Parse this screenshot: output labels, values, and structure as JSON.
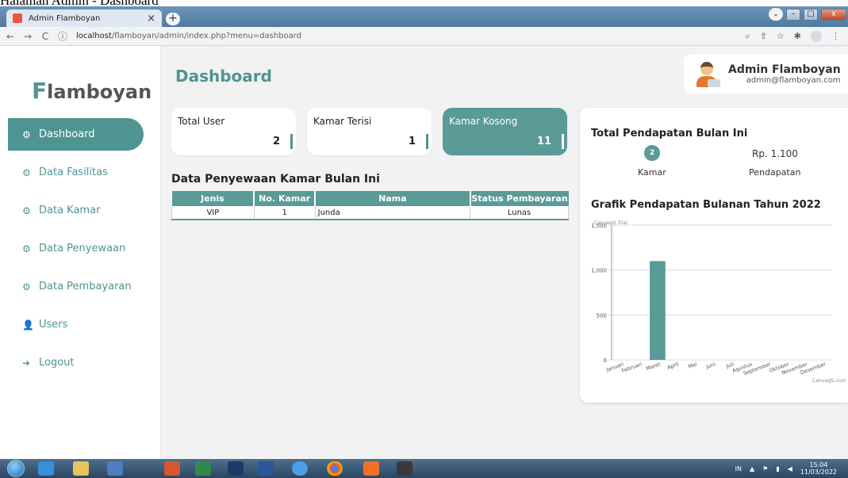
{
  "window_title": "Halaman Admin - Dashboard",
  "browser": {
    "tab_title": "Admin Flamboyan",
    "tab_close": "×",
    "new_tab": "+",
    "url_host": "localhost",
    "url_path": "/flamboyan/admin/index.php?menu=dashboard",
    "window_buttons": {
      "minimize": "–",
      "maximize": "□",
      "close": "x",
      "dropdown": "⌄"
    }
  },
  "brand": {
    "first_letter": "F",
    "rest": "lamboyan"
  },
  "sidebar": {
    "items": [
      {
        "label": "Dashboard",
        "icon": "gauge-icon",
        "glyph": "⚙",
        "active": true
      },
      {
        "label": "Data Fasilitas",
        "icon": "gauge-icon",
        "glyph": "⚙",
        "active": false
      },
      {
        "label": "Data Kamar",
        "icon": "gauge-icon",
        "glyph": "⚙",
        "active": false
      },
      {
        "label": "Data Penyewaan",
        "icon": "gauge-icon",
        "glyph": "⚙",
        "active": false
      },
      {
        "label": "Data Pembayaran",
        "icon": "gauge-icon",
        "glyph": "⚙",
        "active": false
      },
      {
        "label": "Users",
        "icon": "user-icon",
        "glyph": "👤",
        "active": false
      },
      {
        "label": "Logout",
        "icon": "logout-icon",
        "glyph": "➜",
        "active": false
      }
    ]
  },
  "header": {
    "title": "Dashboard"
  },
  "user": {
    "name": "Admin Flamboyan",
    "email": "admin@flamboyan.com"
  },
  "cards": [
    {
      "label": "Total User",
      "value": "2"
    },
    {
      "label": "Kamar Terisi",
      "value": "1"
    },
    {
      "label": "Kamar Kosong",
      "value": "11"
    }
  ],
  "rentals": {
    "title": "Data Penyewaan Kamar Bulan Ini",
    "columns": [
      "Jenis",
      "No. Kamar",
      "Nama",
      "Status Pembayaran"
    ],
    "rows": [
      [
        "VIP",
        "1",
        "Junda",
        "Lunas"
      ]
    ]
  },
  "income": {
    "title": "Total Pendapatan Bulan Ini",
    "kamar_count": "2",
    "kamar_label": "Kamar",
    "amount": "Rp. 1.100",
    "amount_label": "Pendapatan"
  },
  "chart_data": {
    "type": "bar",
    "title": "Grafik Pendapatan Bulanan Tahun 2022",
    "watermark_top": "CanvasJS Trial",
    "watermark_bottom": "CanvasJS.com",
    "categories": [
      "Januari",
      "Februari",
      "Maret",
      "April",
      "Mei",
      "Juni",
      "Juli",
      "Agustus",
      "September",
      "Oktober",
      "November",
      "Desember"
    ],
    "values": [
      0,
      0,
      1100,
      0,
      0,
      0,
      0,
      0,
      0,
      0,
      0,
      0
    ],
    "ylim": [
      0,
      1500
    ],
    "yticks": [
      0,
      500,
      1000,
      1500
    ],
    "ytick_labels": [
      "0",
      "500",
      "1,000",
      "1,500"
    ],
    "bar_color": "#5a9a97",
    "grid": true
  },
  "taskbar": {
    "lang": "IN",
    "time": "15:04",
    "date": "11/03/2022"
  },
  "colors": {
    "accent": "#4e9592",
    "accent_card": "#5a9a97"
  }
}
